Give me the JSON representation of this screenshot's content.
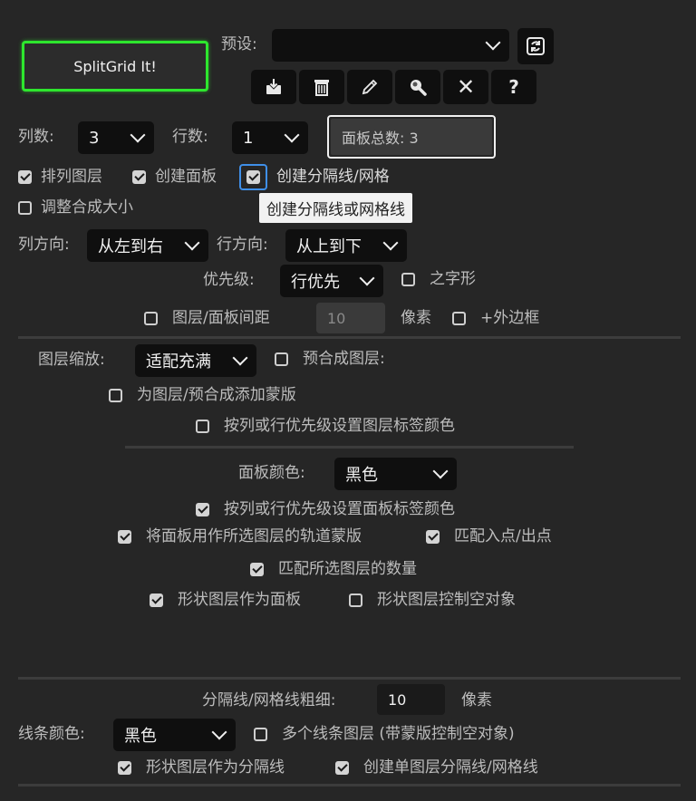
{
  "main_button": "SplitGrid It!",
  "preset": {
    "label": "预设:",
    "value": ""
  },
  "toolbar": {
    "save_icon": "save-icon",
    "delete_icon": "trash-icon",
    "edit_icon": "pencil-icon",
    "search_icon": "magnify-icon",
    "clear_label": "✕",
    "help_label": "?"
  },
  "columns": {
    "label": "列数:",
    "value": "3"
  },
  "rows": {
    "label": "行数:",
    "value": "1"
  },
  "panel_total": "面板总数: 3",
  "options1": {
    "arrange_layers": "排列图层",
    "create_panels": "创建面板",
    "create_dividers": "创建分隔线/网格",
    "resize_comp": "调整合成大小"
  },
  "tooltip": "创建分隔线或网格线",
  "col_direction": {
    "label": "列方向:",
    "value": "从左到右"
  },
  "row_direction": {
    "label": "行方向:",
    "value": "从上到下"
  },
  "priority": {
    "label": "优先级:",
    "value": "行优先",
    "zigzag": "之字形"
  },
  "spacing": {
    "label": "图层/面板间距",
    "value": "10",
    "unit": "像素",
    "outer_border": "+外边框"
  },
  "layer_scale": {
    "label": "图层缩放:",
    "value": "适配充满",
    "precomp": "预合成图层:"
  },
  "add_mask": "为图层/预合成添加蒙版",
  "label_color_layers": "按列或行优先级设置图层标签颜色",
  "panel_color": {
    "label": "面板颜色:",
    "value": "黑色"
  },
  "label_color_panels": "按列或行优先级设置面板标签颜色",
  "track_matte": "将面板用作所选图层的轨道蒙版",
  "match_in_out": "匹配入点/出点",
  "match_count": "匹配所选图层的数量",
  "shape_as_panel": "形状图层作为面板",
  "shape_null": "形状图层控制空对象",
  "line_width": {
    "label": "分隔线/网格线粗细:",
    "value": "10",
    "unit": "像素"
  },
  "line_color": {
    "label": "线条颜色:",
    "value": "黑色",
    "multi_layers": "多个线条图层 (带蒙版控制空对象)"
  },
  "shape_as_divider": "形状图层作为分隔线",
  "single_layer_grid": "创建单图层分隔线/网格线",
  "colors": {
    "accent_green": "#2ee62e",
    "background": "#262626",
    "field": "#0f0f0f"
  }
}
